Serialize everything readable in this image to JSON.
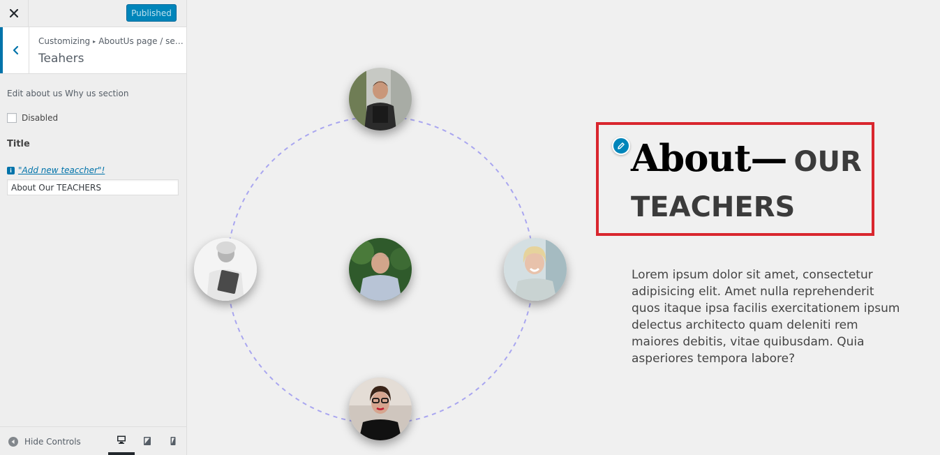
{
  "sidebar": {
    "publish_label": "Published",
    "breadcrumb": {
      "root": "Customizing",
      "separator": "▸",
      "path": "AboutUs page / section"
    },
    "section_title": "Teahers",
    "description": "Edit about us Why us section",
    "disabled_label": "Disabled",
    "disabled_checked": false,
    "title_label": "Title",
    "info_link": "\"Add new teaccher\"!",
    "title_value": "About Our TEACHERS",
    "hide_controls_label": "Hide Controls"
  },
  "devices": [
    "desktop-icon",
    "tablet-icon",
    "mobile-icon"
  ],
  "preview": {
    "heading_about": "About—",
    "heading_our": "OUR",
    "heading_teachers": "TEACHERS",
    "body_text": "Lorem ipsum dolor sit amet, consectetur adipisicing elit. Amet nulla reprehenderit quos itaque ipsa facilis exercitationem ipsum delectus architecto quam deleniti rem maiores debitis, vitae quibusdam. Quia asperiores tempora labore?"
  },
  "colors": {
    "accent": "#0085ba",
    "highlight_border": "#d9262e",
    "ring_dash": "#a9a6f0"
  }
}
